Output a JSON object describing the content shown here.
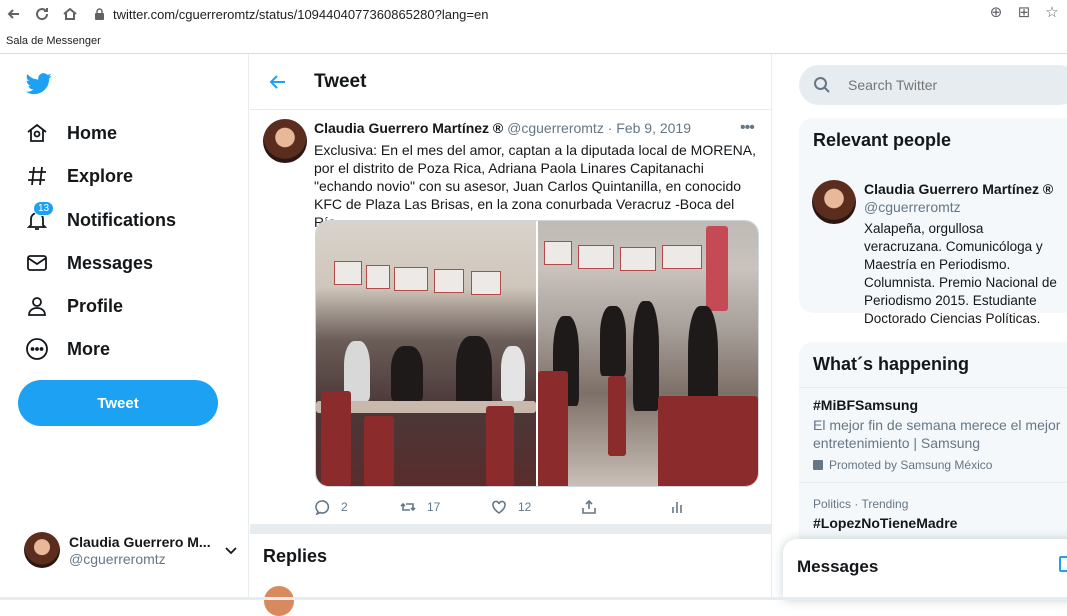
{
  "browser": {
    "url": "twitter.com/cguerreromtz/status/1094404077360865280?lang=en",
    "bookmark": "Sala de Messenger"
  },
  "sidebar": {
    "items": [
      {
        "label": "Home",
        "icon": "home-icon"
      },
      {
        "label": "Explore",
        "icon": "hashtag-icon"
      },
      {
        "label": "Notifications",
        "icon": "bell-icon",
        "badge": "13"
      },
      {
        "label": "Messages",
        "icon": "mail-icon"
      },
      {
        "label": "Profile",
        "icon": "person-icon"
      },
      {
        "label": "More",
        "icon": "more-circle-icon"
      }
    ],
    "tweet_button": "Tweet",
    "account": {
      "name": "Claudia Guerrero M...",
      "handle": "@cguerreromtz"
    }
  },
  "main": {
    "title": "Tweet",
    "tweet": {
      "name": "Claudia Guerrero Martínez ®",
      "handle": "@cguerreromtz",
      "date": "· Feb 9, 2019",
      "text": "Exclusiva: En el mes del amor,  captan a la diputada local de MORENA,  por el distrito de Poza Rica, Adriana Paola Linares Capitanachi \"echando novio\" con su asesor, Juan Carlos Quintanilla,   en conocido KFC de Plaza Las Brisas, en la zona conurbada Veracruz -Boca del Río...",
      "replies": "2",
      "retweets": "17",
      "likes": "12"
    },
    "replies_title": "Replies"
  },
  "right": {
    "search_placeholder": "Search Twitter",
    "relevant": {
      "title": "Relevant people",
      "name": "Claudia Guerrero Martínez ®",
      "handle": "@cguerreromtz",
      "bio": "Xalapeña, orgullosa veracruzana. Comunicóloga y Maestría en Periodismo. Columnista. Premio Nacional de Periodismo 2015. Estudiante Doctorado Ciencias Políticas."
    },
    "happening": {
      "title": "What´s happening",
      "trend1": {
        "tag": "#MiBFSamsung",
        "desc": "El mejor fin de semana merece el mejor entretenimiento | Samsung",
        "promo": "Promoted by Samsung México"
      },
      "trend2": {
        "category": "Politics · Trending",
        "tag": "#LopezNoTieneMadre"
      }
    },
    "messages_drawer": "Messages"
  },
  "colors": {
    "accent": "#1da1f2",
    "text": "#14171a",
    "muted": "#657786",
    "border": "#e6ecf0"
  }
}
